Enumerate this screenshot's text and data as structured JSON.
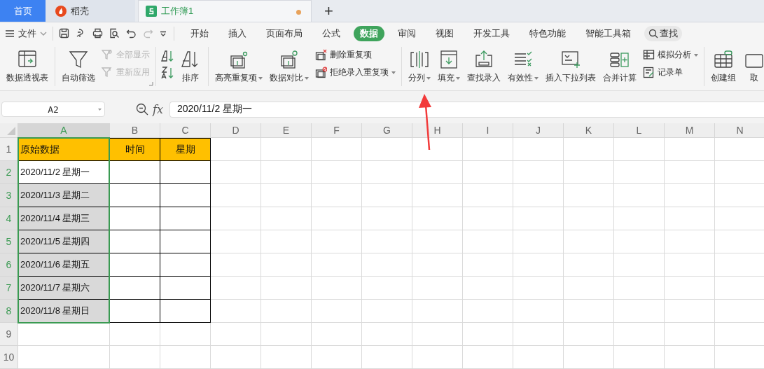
{
  "doc_tabs": [
    {
      "kind": "home",
      "label": "首页",
      "selected": false
    },
    {
      "kind": "app",
      "label": "稻壳",
      "selected": false
    },
    {
      "kind": "doc",
      "label": "工作簿1",
      "selected": true,
      "modified": true
    }
  ],
  "new_tab": "+",
  "menu": {
    "file": "文件",
    "tabs": [
      {
        "label": "开始",
        "selected": false
      },
      {
        "label": "插入",
        "selected": false
      },
      {
        "label": "页面布局",
        "selected": false
      },
      {
        "label": "公式",
        "selected": false
      },
      {
        "label": "数据",
        "selected": true
      },
      {
        "label": "审阅",
        "selected": false
      },
      {
        "label": "视图",
        "selected": false
      },
      {
        "label": "开发工具",
        "selected": false
      },
      {
        "label": "特色功能",
        "selected": false
      },
      {
        "label": "智能工具箱",
        "selected": false
      }
    ],
    "search": "查找"
  },
  "ribbon": [
    {
      "items": [
        {
          "kind": "large",
          "label": "数据透视表",
          "dropdown": false
        }
      ]
    },
    {
      "launcher": true,
      "items": [
        {
          "kind": "large",
          "label": "自动筛选",
          "dropdown": false
        },
        {
          "kind": "stack",
          "items": [
            {
              "label": "全部显示",
              "disabled": true,
              "dropdown": false
            },
            {
              "label": "重新应用",
              "disabled": true,
              "dropdown": false
            }
          ]
        }
      ]
    },
    {
      "items": [
        {
          "kind": "sort-icons"
        },
        {
          "kind": "large",
          "label": "排序",
          "dropdown": false
        }
      ]
    },
    {
      "items": [
        {
          "kind": "large",
          "label": "高亮重复项",
          "dropdown": true
        },
        {
          "kind": "large",
          "label": "数据对比",
          "dropdown": true
        },
        {
          "kind": "stack",
          "items": [
            {
              "label": "删除重复项",
              "disabled": false,
              "dropdown": false
            },
            {
              "label": "拒绝录入重复项",
              "disabled": false,
              "dropdown": true
            }
          ]
        }
      ]
    },
    {
      "items": [
        {
          "kind": "large",
          "label": "分列",
          "dropdown": true
        },
        {
          "kind": "large",
          "label": "填充",
          "dropdown": true
        },
        {
          "kind": "large",
          "label": "查找录入",
          "dropdown": false
        },
        {
          "kind": "large",
          "label": "有效性",
          "dropdown": true
        },
        {
          "kind": "large",
          "label": "插入下拉列表",
          "dropdown": false
        },
        {
          "kind": "large",
          "label": "合并计算",
          "dropdown": false
        },
        {
          "kind": "stack",
          "items": [
            {
              "label": "模拟分析",
              "disabled": false,
              "dropdown": true
            },
            {
              "label": "记录单",
              "disabled": false,
              "dropdown": false
            }
          ]
        }
      ]
    },
    {
      "items": [
        {
          "kind": "large",
          "label": "创建组",
          "dropdown": false
        },
        {
          "kind": "large",
          "label": "取",
          "dropdown": false
        }
      ]
    }
  ],
  "formula_bar": {
    "name_box": "A2",
    "fx": "fx",
    "value": "2020/11/2 星期一"
  },
  "sheet": {
    "columns": [
      {
        "label": "A",
        "selected": true
      },
      {
        "label": "B",
        "selected": false
      },
      {
        "label": "C",
        "selected": false
      },
      {
        "label": "D",
        "selected": false
      },
      {
        "label": "E",
        "selected": false
      },
      {
        "label": "F",
        "selected": false
      },
      {
        "label": "G",
        "selected": false
      },
      {
        "label": "H",
        "selected": false
      },
      {
        "label": "I",
        "selected": false
      },
      {
        "label": "J",
        "selected": false
      },
      {
        "label": "K",
        "selected": false
      },
      {
        "label": "L",
        "selected": false
      },
      {
        "label": "M",
        "selected": false
      },
      {
        "label": "N",
        "selected": false
      }
    ],
    "rows": [
      {
        "label": "1",
        "kind": "header",
        "selected": false,
        "cells": [
          {
            "text": "原始数据",
            "selected": false
          },
          {
            "text": "时间",
            "selected": false
          },
          {
            "text": "星期",
            "selected": false
          }
        ]
      },
      {
        "label": "2",
        "kind": "data",
        "selected": true,
        "cells": [
          {
            "text": "2020/11/2 星期一",
            "selected": false
          },
          {
            "selected": false
          },
          {
            "selected": false
          }
        ]
      },
      {
        "label": "3",
        "kind": "data",
        "selected": true,
        "cells": [
          {
            "text": "2020/11/3 星期二",
            "selected": true
          },
          {
            "selected": false
          },
          {
            "selected": false
          }
        ]
      },
      {
        "label": "4",
        "kind": "data",
        "selected": true,
        "cells": [
          {
            "text": "2020/11/4 星期三",
            "selected": true
          },
          {
            "selected": false
          },
          {
            "selected": false
          }
        ]
      },
      {
        "label": "5",
        "kind": "data",
        "selected": true,
        "cells": [
          {
            "text": "2020/11/5 星期四",
            "selected": true
          },
          {
            "selected": false
          },
          {
            "selected": false
          }
        ]
      },
      {
        "label": "6",
        "kind": "data",
        "selected": true,
        "cells": [
          {
            "text": "2020/11/6 星期五",
            "selected": true
          },
          {
            "selected": false
          },
          {
            "selected": false
          }
        ]
      },
      {
        "label": "7",
        "kind": "data",
        "selected": true,
        "cells": [
          {
            "text": "2020/11/7 星期六",
            "selected": true
          },
          {
            "selected": false
          },
          {
            "selected": false
          }
        ]
      },
      {
        "label": "8",
        "kind": "data",
        "selected": true,
        "cells": [
          {
            "text": "2020/11/8 星期日",
            "selected": true
          },
          {
            "selected": false
          },
          {
            "selected": false
          }
        ]
      },
      {
        "label": "9",
        "kind": "blank",
        "selected": false
      },
      {
        "label": "10",
        "kind": "blank",
        "selected": false
      }
    ]
  },
  "annotation": {
    "kind": "arrow"
  }
}
